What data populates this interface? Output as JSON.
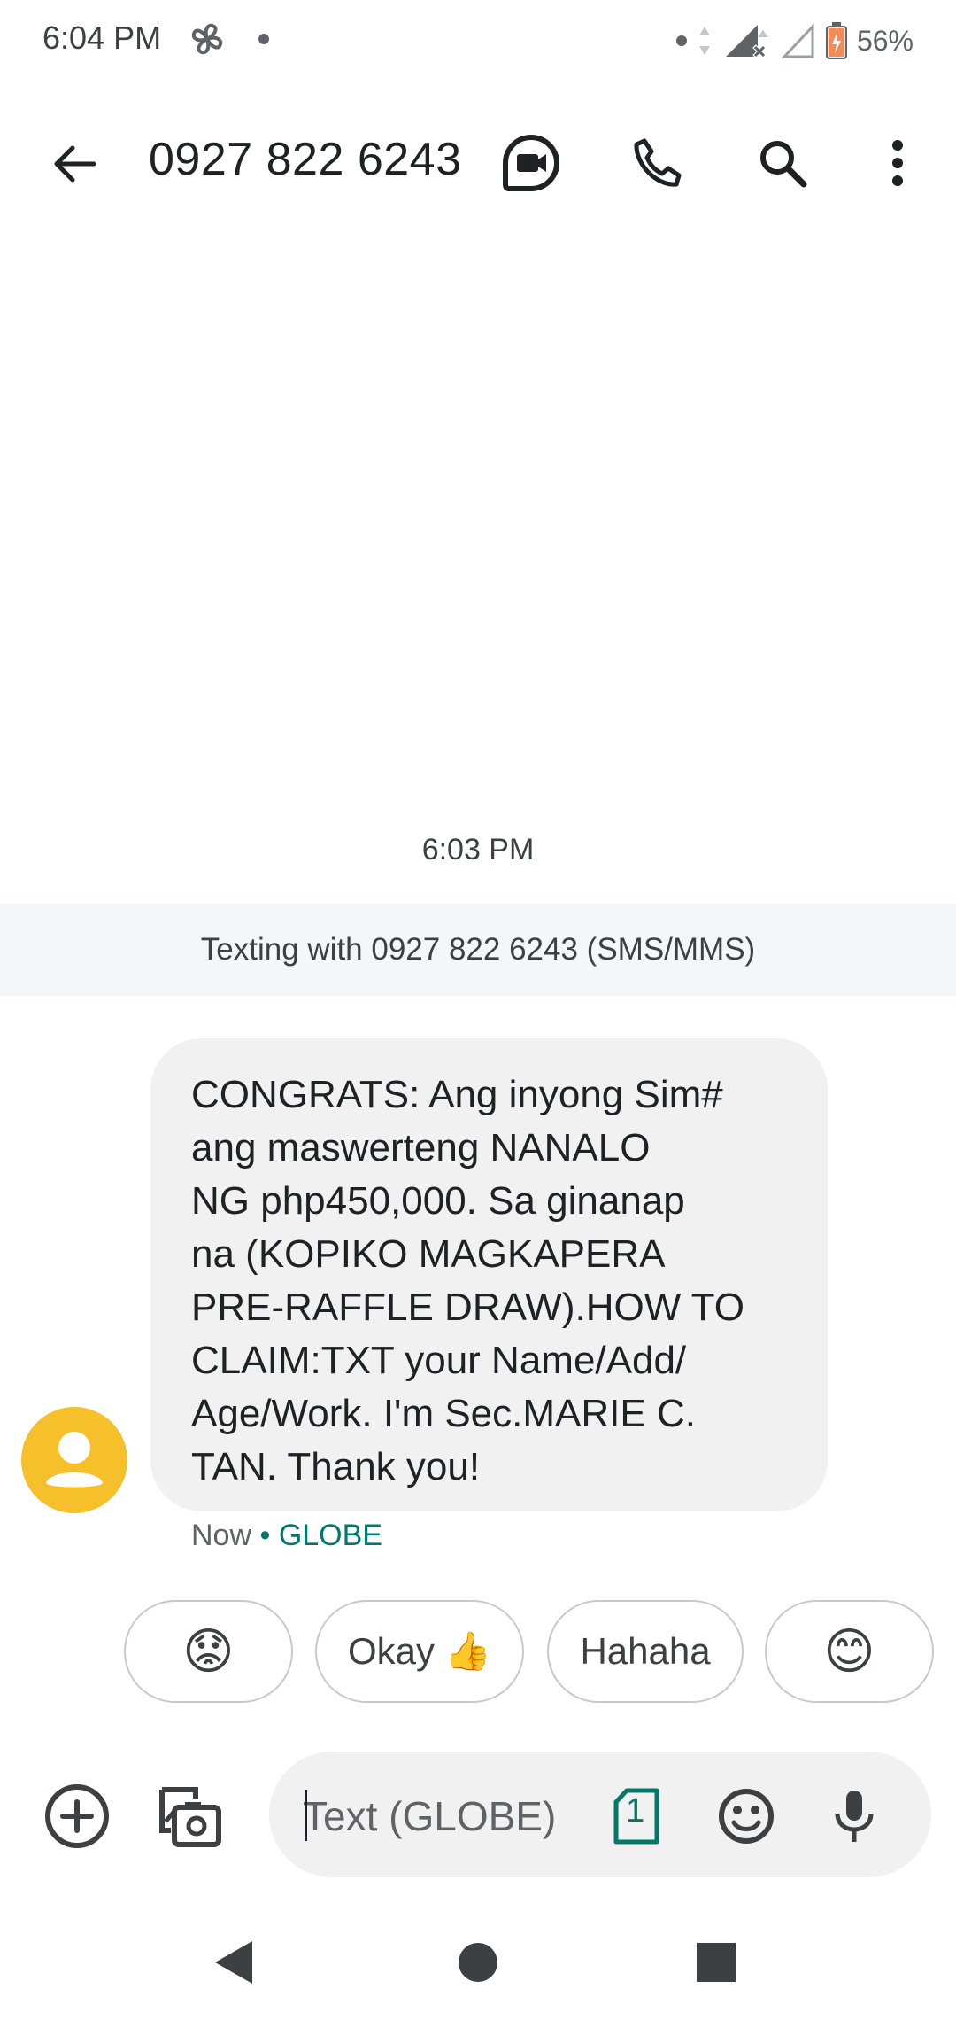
{
  "status_bar": {
    "time": "6:04 PM",
    "battery_percent": "56%",
    "icons": [
      "fan-icon",
      "notification-dot-icon",
      "data-arrows-icon",
      "signal-no-service-icon",
      "signal-empty-icon",
      "battery-charging-icon"
    ]
  },
  "header": {
    "title": "0927 822 6243",
    "actions": [
      "video-call-icon",
      "phone-icon",
      "search-icon",
      "more-vert-icon"
    ]
  },
  "conversation": {
    "timestamp": "6:03 PM",
    "banner": "Texting with 0927 822 6243 (SMS/MMS)",
    "message": {
      "text": "CONGRATS: Ang inyong Sim#\nang maswerteng NANALO\nNG php450,000. Sa ginanap\nna (KOPIKO MAGKAPERA\nPRE-RAFFLE DRAW).HOW TO\nCLAIM:TXT your Name/Add/\nAge/Work. I'm Sec.MARIE  C.\nTAN. Thank you!",
      "time": "Now",
      "separator": " • ",
      "carrier": "GLOBE"
    }
  },
  "suggestions": [
    {
      "label": "😟"
    },
    {
      "label": "Okay 👍"
    },
    {
      "label": "Hahaha"
    },
    {
      "label": "😊"
    }
  ],
  "compose": {
    "placeholder": "Text (GLOBE)",
    "sim_label": "1"
  },
  "colors": {
    "accent": "#00796b",
    "avatar": "#f6c02a",
    "bubble": "#f1f1f1",
    "banner": "#f4f6f9"
  }
}
